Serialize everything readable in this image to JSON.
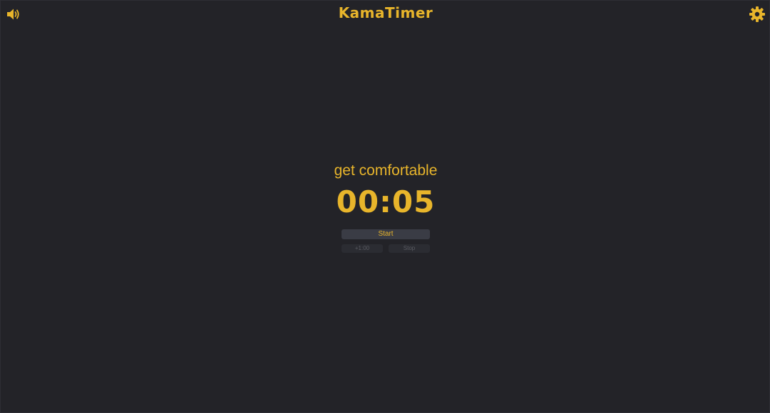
{
  "header": {
    "logo": "KamaTimer",
    "sound_icon": "speaker-volume-icon",
    "settings_icon": "gear-icon"
  },
  "timer": {
    "step_label": "get comfortable",
    "time": "00:05"
  },
  "controls": {
    "start_label": "Start",
    "add_minute_label": "+1:00",
    "stop_label": "Stop"
  },
  "colors": {
    "background": "#232328",
    "accent": "#e8b52b",
    "button_primary_bg": "#3a3c45",
    "button_disabled_bg": "#2b2c32",
    "button_disabled_text": "#5a5b62"
  }
}
